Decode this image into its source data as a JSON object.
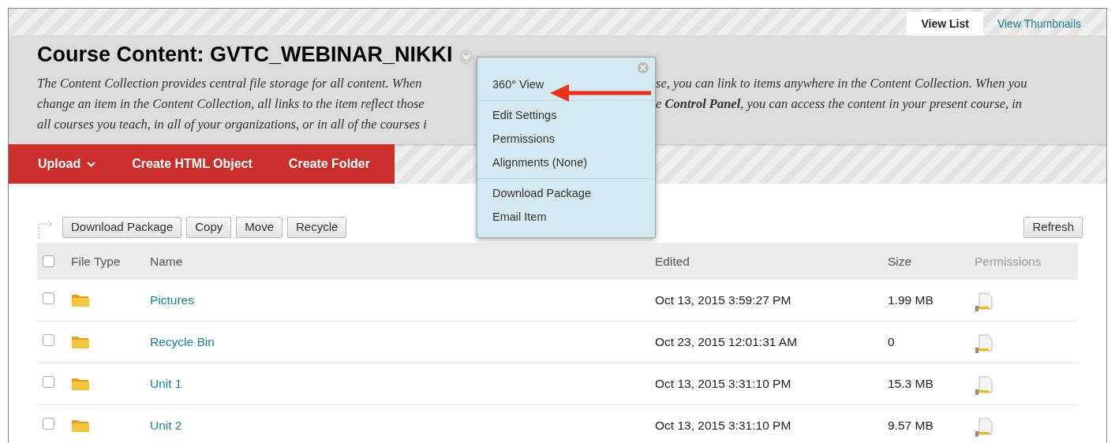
{
  "view_tabs": [
    {
      "label": "View List",
      "selected": true
    },
    {
      "label": "View Thumbnails",
      "selected": false
    }
  ],
  "title": "Course Content: GVTC_WEBINAR_NIKKI",
  "description_lines": [
    {
      "left": "The Content Collection provides central file storage for all content. When",
      "right": "se, you can link to items anywhere in the Content Collection. When you"
    },
    {
      "left": "change an item in the Content Collection, all links to the item reflect those",
      "right": "e **Control Panel**, you can access the content in your present course, in"
    },
    {
      "left": "all courses you teach, in all of your organizations, or in all of the courses i"
    }
  ],
  "action_bar": [
    {
      "label": "Upload",
      "has_menu": true
    },
    {
      "label": "Create HTML Object",
      "has_menu": false
    },
    {
      "label": "Create Folder",
      "has_menu": false
    }
  ],
  "bulk_buttons": [
    "Download Package",
    "Copy",
    "Move",
    "Recycle"
  ],
  "refresh_button": "Refresh",
  "table": {
    "select_all_checked": false,
    "columns": [
      {
        "label": "File Type",
        "muted": false
      },
      {
        "label": "Name",
        "muted": false
      },
      {
        "label": "Edited",
        "muted": false
      },
      {
        "label": "Size",
        "muted": false
      },
      {
        "label": "Permissions",
        "muted": true
      }
    ],
    "rows": [
      {
        "checked": false,
        "name": "Pictures",
        "edited": "Oct 13, 2015 3:59:27 PM",
        "size": "1.99 MB"
      },
      {
        "checked": false,
        "name": "Recycle Bin",
        "edited": "Oct 23, 2015 12:01:31 AM",
        "size": "0"
      },
      {
        "checked": false,
        "name": "Unit 1",
        "edited": "Oct 13, 2015 3:31:10 PM",
        "size": "15.3 MB"
      },
      {
        "checked": false,
        "name": "Unit 2",
        "edited": "Oct 13, 2015 3:31:10 PM",
        "size": "9.57 MB"
      }
    ]
  },
  "context_menu": {
    "groups": [
      [
        "360° View"
      ],
      [
        "Edit Settings",
        "Permissions",
        "Alignments (None)"
      ],
      [
        "Download Package",
        "Email Item"
      ]
    ]
  }
}
